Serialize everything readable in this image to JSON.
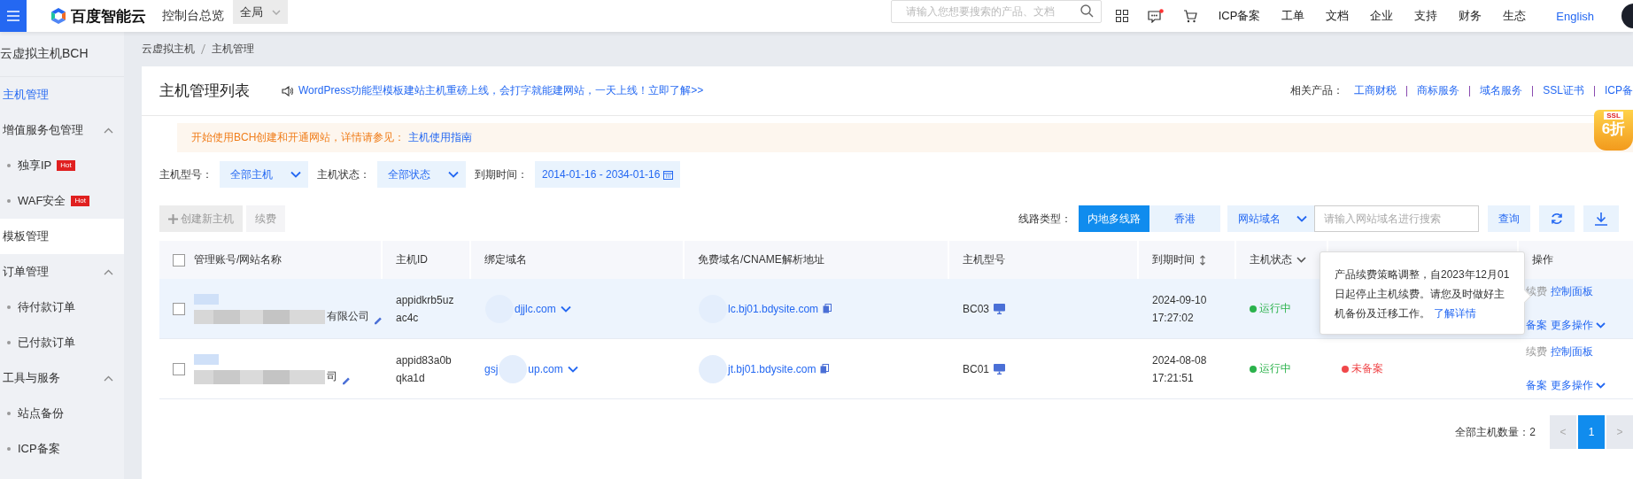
{
  "topbar": {
    "logo": "百度智能云",
    "console": "控制台总览",
    "scope": "全局",
    "search_placeholder": "请输入您想要搜索的产品、文档",
    "message_unread": true,
    "links": [
      "ICP备案",
      "工单",
      "文档",
      "企业",
      "支持",
      "财务",
      "生态"
    ],
    "language": "English"
  },
  "sidebar": {
    "title": "云虚拟主机BCH",
    "items": [
      {
        "kind": "link",
        "label": "主机管理",
        "selected": true,
        "highlighted": false
      },
      {
        "kind": "group",
        "label": "增值服务包管理",
        "expanded": true,
        "children": [
          {
            "label": "独享IP",
            "badge": "Hot"
          },
          {
            "label": "WAF安全",
            "badge": "Hot"
          }
        ]
      },
      {
        "kind": "link",
        "label": "模板管理",
        "selected": false,
        "highlighted": true
      },
      {
        "kind": "group",
        "label": "订单管理",
        "expanded": true,
        "children": [
          {
            "label": "待付款订单"
          },
          {
            "label": "已付款订单"
          }
        ]
      },
      {
        "kind": "group",
        "label": "工具与服务",
        "expanded": true,
        "children": [
          {
            "label": "站点备份"
          },
          {
            "label": "ICP备案"
          }
        ]
      }
    ]
  },
  "breadcrumb": [
    "云虚拟主机",
    "主机管理"
  ],
  "page": {
    "title": "主机管理列表",
    "announcement": "WordPress功能型模板建站主机重磅上线，会打字就能建网站，一天上线！立即了解>>",
    "related_label": "相关产品：",
    "related_links": [
      "工商财税",
      "商标服务",
      "域名服务",
      "SSL证书",
      "ICP备"
    ],
    "promo_badge": {
      "title": "SSL",
      "discount": "6折"
    }
  },
  "notice": {
    "text": "开始使用BCH创建和开通网站，详情请参见：",
    "link": "主机使用指南"
  },
  "filters": [
    {
      "kind": "select",
      "label": "主机型号：",
      "value": "全部主机"
    },
    {
      "kind": "select",
      "label": "主机状态：",
      "value": "全部状态"
    },
    {
      "kind": "date",
      "label": "到期时间：",
      "value": "2014-01-16 - 2034-01-16"
    }
  ],
  "toolbar": {
    "create": {
      "label": "创建新主机",
      "disabled": true
    },
    "renew": {
      "label": "续费",
      "disabled": true
    },
    "line_label": "线路类型：",
    "lines": [
      {
        "label": "内地多线路",
        "selected": true
      },
      {
        "label": "香港",
        "selected": false
      }
    ],
    "search_by": "网站域名",
    "search_placeholder": "请输入网站域名进行搜索",
    "query": "查询"
  },
  "table": {
    "select_all": false,
    "columns": [
      {
        "label": "管理账号/网站名称",
        "kind": "plain"
      },
      {
        "label": "主机ID",
        "kind": "plain"
      },
      {
        "label": "绑定域名",
        "kind": "plain"
      },
      {
        "label": "免费域名/CNAME解析地址",
        "kind": "plain"
      },
      {
        "label": "主机型号",
        "kind": "plain"
      },
      {
        "label": "到期时间",
        "kind": "sort"
      },
      {
        "label": "主机状态",
        "kind": "filter"
      },
      {
        "label": "操作",
        "kind": "plain"
      }
    ],
    "rows": [
      {
        "selected": false,
        "highlighted": true,
        "site_name_end": "有限公司",
        "host_id": [
          "appidkrb5uz",
          "ac4c"
        ],
        "domain_after": "djjlc.com",
        "free_domain": "lc.bj01.bdysite.com",
        "model": "BC03",
        "expire": [
          "2024-09-10",
          "17:27:02"
        ],
        "status": {
          "text": "运行中",
          "color": "#2bb24c"
        },
        "actions": [
          {
            "label": "续费",
            "disabled": true
          },
          {
            "label": "控制面板",
            "disabled": false
          },
          {
            "label": "备案",
            "disabled": false
          },
          {
            "label": "更多操作",
            "disabled": false,
            "menu": true
          }
        ]
      },
      {
        "selected": false,
        "highlighted": false,
        "site_name_end": "司",
        "host_id": [
          "appid83a0b",
          "qka1d"
        ],
        "domain_before": "gsj",
        "domain_after": "up.com",
        "free_domain": "jt.bj01.bdysite.com",
        "model": "BC01",
        "expire": [
          "2024-08-08",
          "17:21:51"
        ],
        "status": {
          "text": "运行中",
          "color": "#2bb24c"
        },
        "record": {
          "text": "未备案",
          "color": "#f0474a"
        },
        "actions": [
          {
            "label": "续费",
            "disabled": true
          },
          {
            "label": "控制面板",
            "disabled": false
          },
          {
            "label": "备案",
            "disabled": false
          },
          {
            "label": "更多操作",
            "disabled": false,
            "menu": true
          }
        ]
      }
    ]
  },
  "tooltip": {
    "text": "产品续费策略调整，自2023年12月01日起停止主机续费。请您及时做好主机备份及迁移工作。",
    "link": "了解详情"
  },
  "pagination": {
    "total_label": "全部主机数量：2",
    "prev": {
      "label": "<",
      "disabled": true
    },
    "pages": [
      {
        "label": "1",
        "selected": true
      }
    ],
    "next": {
      "label": ">",
      "disabled": true
    }
  }
}
